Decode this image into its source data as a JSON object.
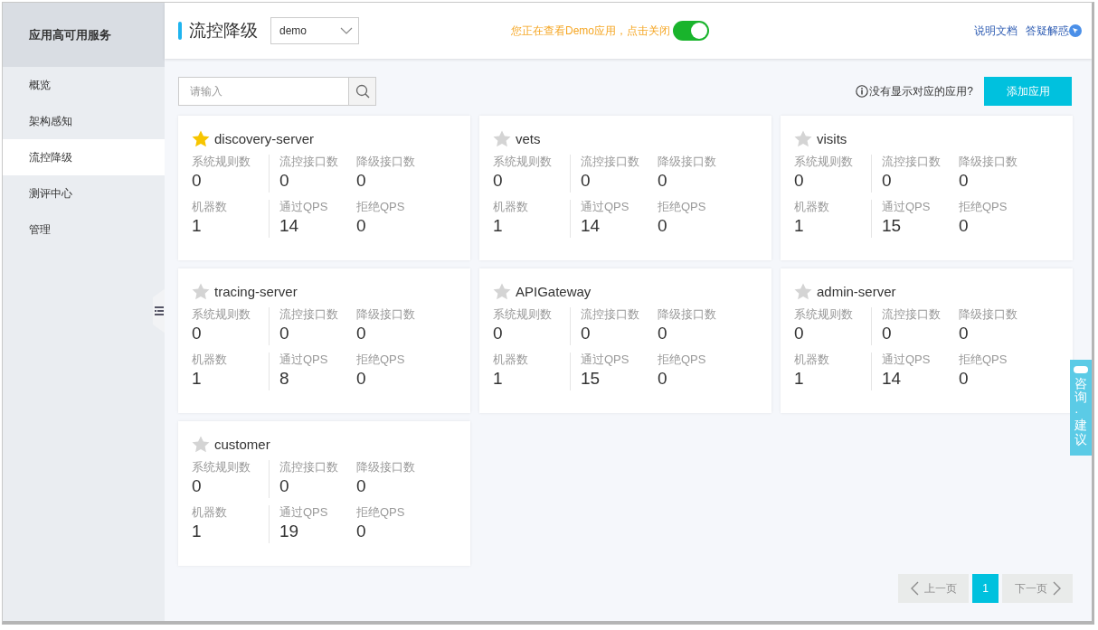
{
  "sidebar": {
    "title": "应用高可用服务",
    "items": [
      {
        "label": "概览",
        "selected": false
      },
      {
        "label": "架构感知",
        "selected": false
      },
      {
        "label": "流控降级",
        "selected": true
      },
      {
        "label": "测评中心",
        "selected": false
      },
      {
        "label": "管理",
        "selected": false
      }
    ]
  },
  "header": {
    "title": "流控降级",
    "app_select": {
      "value": "demo"
    },
    "demo_notice": "您正在查看Demo应用，点击关闭",
    "demo_toggle": {
      "on": true
    },
    "links": [
      "说明文档",
      "答疑解惑"
    ]
  },
  "search": {
    "placeholder": "请输入"
  },
  "missing_hint": "没有显示对应的应用?",
  "add_button": "添加应用",
  "apps": [
    {
      "name": "discovery-server",
      "starred": true,
      "stats": [
        {
          "label": "系统规则数",
          "value": "0"
        },
        {
          "label": "流控接口数",
          "value": "0"
        },
        {
          "label": "降级接口数",
          "value": "0"
        },
        {
          "label": "机器数",
          "value": "1"
        },
        {
          "label": "通过QPS",
          "value": "14"
        },
        {
          "label": "拒绝QPS",
          "value": "0"
        }
      ]
    },
    {
      "name": "vets",
      "starred": false,
      "stats": [
        {
          "label": "系统规则数",
          "value": "0"
        },
        {
          "label": "流控接口数",
          "value": "0"
        },
        {
          "label": "降级接口数",
          "value": "0"
        },
        {
          "label": "机器数",
          "value": "1"
        },
        {
          "label": "通过QPS",
          "value": "14"
        },
        {
          "label": "拒绝QPS",
          "value": "0"
        }
      ]
    },
    {
      "name": "visits",
      "starred": false,
      "stats": [
        {
          "label": "系统规则数",
          "value": "0"
        },
        {
          "label": "流控接口数",
          "value": "0"
        },
        {
          "label": "降级接口数",
          "value": "0"
        },
        {
          "label": "机器数",
          "value": "1"
        },
        {
          "label": "通过QPS",
          "value": "15"
        },
        {
          "label": "拒绝QPS",
          "value": "0"
        }
      ]
    },
    {
      "name": "tracing-server",
      "starred": false,
      "stats": [
        {
          "label": "系统规则数",
          "value": "0"
        },
        {
          "label": "流控接口数",
          "value": "0"
        },
        {
          "label": "降级接口数",
          "value": "0"
        },
        {
          "label": "机器数",
          "value": "1"
        },
        {
          "label": "通过QPS",
          "value": "8"
        },
        {
          "label": "拒绝QPS",
          "value": "0"
        }
      ]
    },
    {
      "name": "APIGateway",
      "starred": false,
      "stats": [
        {
          "label": "系统规则数",
          "value": "0"
        },
        {
          "label": "流控接口数",
          "value": "0"
        },
        {
          "label": "降级接口数",
          "value": "0"
        },
        {
          "label": "机器数",
          "value": "1"
        },
        {
          "label": "通过QPS",
          "value": "15"
        },
        {
          "label": "拒绝QPS",
          "value": "0"
        }
      ]
    },
    {
      "name": "admin-server",
      "starred": false,
      "stats": [
        {
          "label": "系统规则数",
          "value": "0"
        },
        {
          "label": "流控接口数",
          "value": "0"
        },
        {
          "label": "降级接口数",
          "value": "0"
        },
        {
          "label": "机器数",
          "value": "1"
        },
        {
          "label": "通过QPS",
          "value": "14"
        },
        {
          "label": "拒绝QPS",
          "value": "0"
        }
      ]
    },
    {
      "name": "customer",
      "starred": false,
      "stats": [
        {
          "label": "系统规则数",
          "value": "0"
        },
        {
          "label": "流控接口数",
          "value": "0"
        },
        {
          "label": "降级接口数",
          "value": "0"
        },
        {
          "label": "机器数",
          "value": "1"
        },
        {
          "label": "通过QPS",
          "value": "19"
        },
        {
          "label": "拒绝QPS",
          "value": "0"
        }
      ]
    }
  ],
  "pagination": {
    "prev": {
      "label": "上一页",
      "disabled": true
    },
    "pages": [
      {
        "label": "1",
        "selected": true
      }
    ],
    "next": {
      "label": "下一页",
      "disabled": true
    }
  },
  "feedback_tab": "咨询·建议"
}
